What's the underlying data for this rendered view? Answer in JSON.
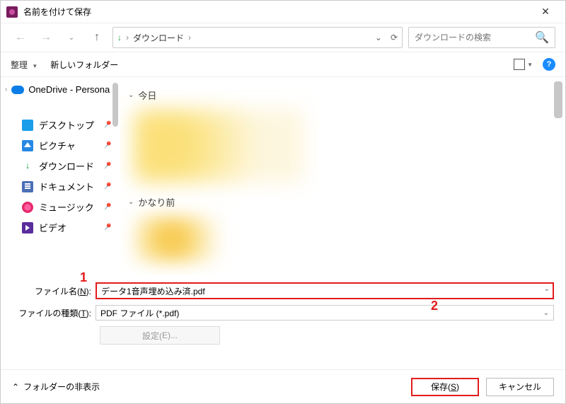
{
  "window": {
    "title": "名前を付けて保存"
  },
  "nav": {
    "path_parts": {
      "root": "ダウンロード"
    },
    "search_placeholder": "ダウンロードの検索"
  },
  "toolbar": {
    "organize": "整理",
    "new_folder": "新しいフォルダー"
  },
  "sidebar": {
    "onedrive": "OneDrive - Persona",
    "items": [
      {
        "label": "デスクトップ",
        "icon": "desktop"
      },
      {
        "label": "ピクチャ",
        "icon": "pictures"
      },
      {
        "label": "ダウンロード",
        "icon": "downloads"
      },
      {
        "label": "ドキュメント",
        "icon": "documents"
      },
      {
        "label": "ミュージック",
        "icon": "music"
      },
      {
        "label": "ビデオ",
        "icon": "videos"
      }
    ]
  },
  "content": {
    "group_today": "今日",
    "group_long_ago": "かなり前"
  },
  "form": {
    "filename_label_pre": "ファイル名(",
    "filename_label_key": "N",
    "filename_label_post": "):",
    "filename_value": "データ1音声埋め込み済.pdf",
    "filetype_label_pre": "ファイルの種類(",
    "filetype_label_key": "T",
    "filetype_label_post": "):",
    "filetype_value": "PDF ファイル (*.pdf)",
    "settings_label_pre": "設定(",
    "settings_label_key": "E",
    "settings_label_post": ")..."
  },
  "callouts": {
    "one": "1",
    "two": "2"
  },
  "footer": {
    "hide_folders": "フォルダーの非表示",
    "save_pre": "保存(",
    "save_key": "S",
    "save_post": ")",
    "cancel": "キャンセル"
  }
}
